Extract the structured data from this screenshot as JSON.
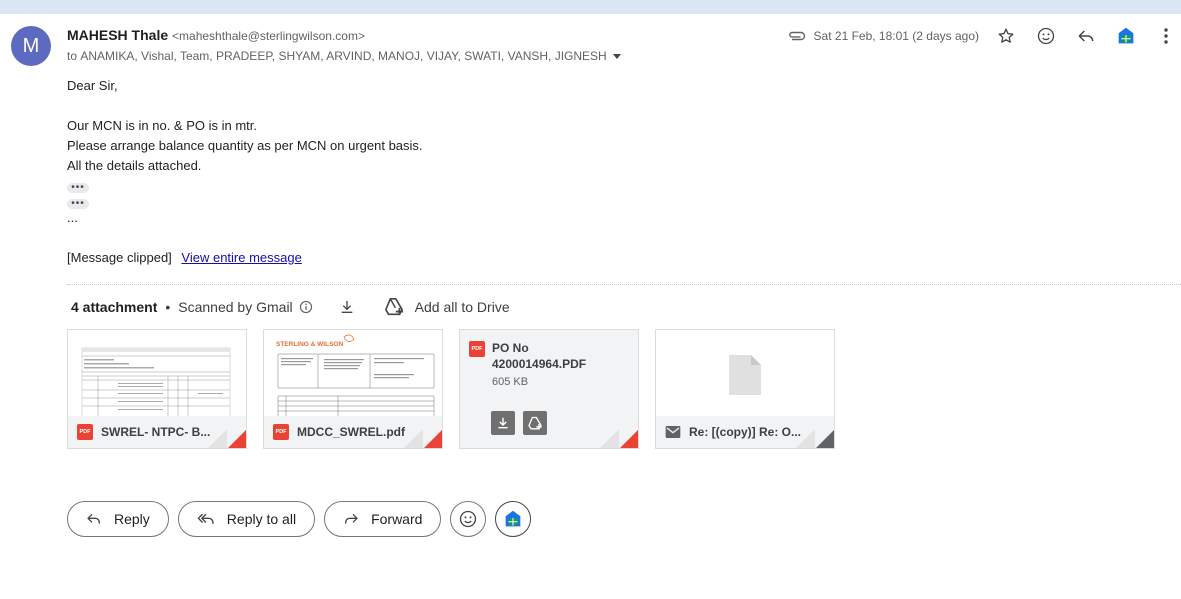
{
  "header": {
    "avatar_letter": "M",
    "sender_name": "MAHESH Thale",
    "sender_email": "<maheshthale@sterlingwilson.com>",
    "to_prefix": "to",
    "recipients": "ANAMIKA, Vishal, Team, PRADEEP, SHYAM, ARVIND, MANOJ, VIJAY, SWATI, VANSH, JIGNESH",
    "date": "Sat 21 Feb, 18:01 (2 days ago)"
  },
  "message": {
    "greeting": "Dear Sir,",
    "line1": "Our MCN is in no. & PO is in mtr.",
    "line2": "Please arrange balance quantity as per MCN on urgent basis.",
    "line3": "All the details attached.",
    "dots": "•••",
    "ellipsis": "...",
    "clipped_text": "[Message clipped]",
    "view_entire_link": "View entire message"
  },
  "attachments": {
    "count_label": "4 attachment",
    "bullet": "•",
    "scanned_label": "Scanned by Gmail",
    "add_all_drive": "Add all to Drive",
    "pdf_label": "PDF",
    "items": [
      {
        "name": "SWREL- NTPC- B..."
      },
      {
        "name": "MDCC_SWREL.pdf"
      },
      {
        "name_line1": "PO No",
        "name_line2": "4200014964.PDF",
        "size": "605 KB"
      },
      {
        "name": "Re: [(copy)] Re: O..."
      }
    ]
  },
  "actions": {
    "reply": "Reply",
    "reply_all": "Reply to all",
    "forward": "Forward"
  },
  "colors": {
    "avatar_bg": "#5c6bc0",
    "pdf_red": "#ea4335",
    "link": "#1a0dab",
    "sheets_green": "#0f9d58",
    "sheets_blue": "#1a73e8"
  }
}
